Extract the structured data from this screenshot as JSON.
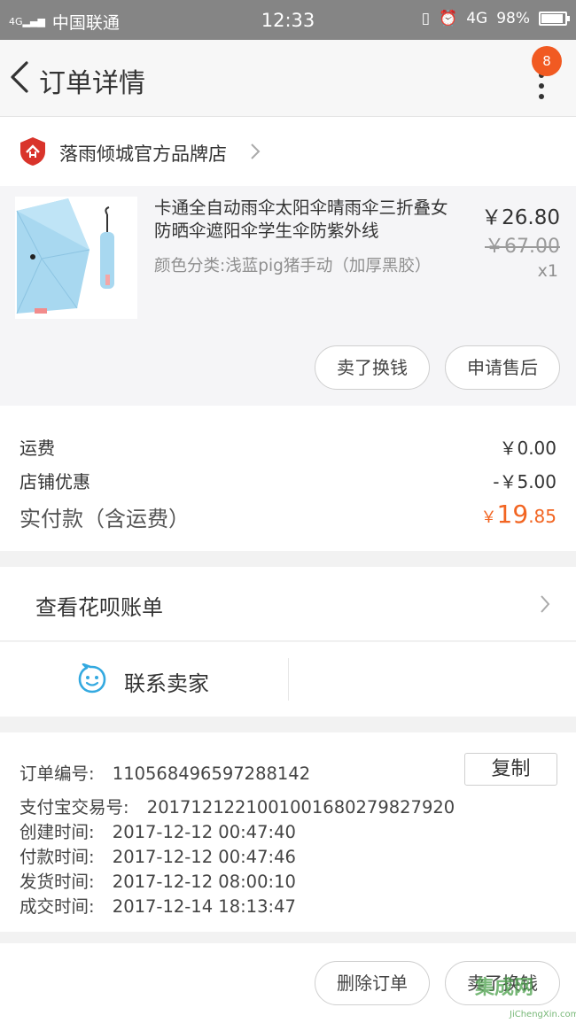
{
  "status_bar": {
    "network": "4G",
    "carrier": "中国联通",
    "time": "12:33",
    "data_type": "4G",
    "battery": "98%"
  },
  "nav": {
    "title": "订单详情",
    "badge_count": "8"
  },
  "shop": {
    "name": "落雨倾城官方品牌店"
  },
  "item": {
    "title": "卡通全自动雨伞太阳伞晴雨伞三折叠女防晒伞遮阳伞学生伞防紫外线",
    "sku": "颜色分类:浅蓝pig猪手动（加厚黑胶）",
    "price": "￥26.80",
    "original_price": "￥67.00",
    "quantity": "x1",
    "sell_button": "卖了换钱",
    "aftersale_button": "申请售后"
  },
  "fees": {
    "shipping_label": "运费",
    "shipping_value": "￥0.00",
    "discount_label": "店铺优惠",
    "discount_value": "-￥5.00",
    "paid_label": "实付款（含运费）",
    "paid_currency": "￥",
    "paid_int": "19",
    "paid_dec": ".85"
  },
  "huabei": {
    "label": "查看花呗账单"
  },
  "contact": {
    "label": "联系卖家"
  },
  "order_info": {
    "order_no_label": "订单编号:",
    "order_no": "110568496597288142",
    "copy_button": "复制",
    "alipay_label": "支付宝交易号:",
    "alipay_no": "2017121221001001680279827920",
    "created_label": "创建时间:",
    "created": "2017-12-12 00:47:40",
    "paid_label": "付款时间:",
    "paid": "2017-12-12 00:47:46",
    "shipped_label": "发货时间:",
    "shipped": "2017-12-12 08:00:10",
    "closed_label": "成交时间:",
    "closed": "2017-12-14 18:13:47"
  },
  "bottom": {
    "delete_button": "删除订单",
    "sell_button": "卖了换钱"
  },
  "watermark": {
    "text": "集成网",
    "sub": "JiChengXin.com"
  },
  "colors": {
    "accent": "#f26522",
    "badge": "#f15a22",
    "status_bar": "#858585",
    "shop_logo": "#d9342b",
    "contact_icon": "#33a9e0"
  }
}
